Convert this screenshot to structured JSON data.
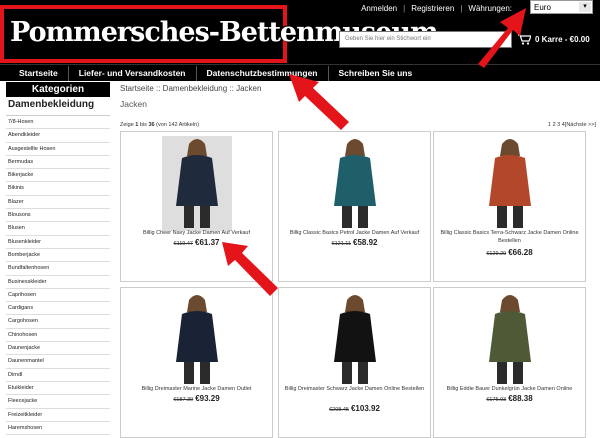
{
  "header": {
    "logo": "Pommersches-Bettenmuseum",
    "links": [
      "Anmelden",
      "Registrieren",
      "Währungen:"
    ],
    "currency": "Euro",
    "search_placeholder": "Geben Sie hier ein Stichwort ein",
    "cart_label": "0 Karre - €0.00"
  },
  "nav": [
    "Startseite",
    "Liefer- und Versandkosten",
    "Datenschutzbestimmungen",
    "Schreiben Sie uns"
  ],
  "sidebar": {
    "title": "Kategorien",
    "subtitle": "Damenbekleidung",
    "items": [
      "7/8-Hosen",
      "Abendkleider",
      "Ausgestellte Hosen",
      "Bermudas",
      "Bikerjacke",
      "Bikinis",
      "Blazer",
      "Blousons",
      "Blusen",
      "Blusenkleider",
      "Bomberjacke",
      "Bundfaltenhosen",
      "Businesskleider",
      "Caprihosen",
      "Cardigans",
      "Cargohosen",
      "Chinohosen",
      "Daunenjacke",
      "Daunenmantel",
      "Dirndl",
      "Etuikleider",
      "Fleecejacke",
      "Freizeitkleider",
      "Haremshosen"
    ]
  },
  "main": {
    "breadcrumb": "Startseite :: Damenbekleidung :: Jacken",
    "title": "Jacken",
    "count_prefix": "Zeige ",
    "count_from": "1",
    "count_mid": " bis ",
    "count_to": "36",
    "count_suffix": " (von 142 Artikeln)",
    "pager": "1 2 3 4[Nächste >>]"
  },
  "products": [
    {
      "name": "Billig Cheer Navy Jacke Damen Auf Verkauf",
      "old_price": "€119.47",
      "price": "€61.37",
      "color": "#1f2a3c"
    },
    {
      "name": "Billig Classic Basics Petrol Jacke Damen Auf Verkauf",
      "old_price": "€121.11",
      "price": "€58.92",
      "color": "#1f5f6a"
    },
    {
      "name": "Billig Classic Basics Terra-Schwarz Jacke Damen Online Bestellen",
      "old_price": "€129.29",
      "price": "€66.28",
      "color": "#b2472a"
    },
    {
      "name": "Billig Dreimaster Marine Jacke Damen Outlet",
      "old_price": "€187.39",
      "price": "€93.29",
      "color": "#1a2236"
    },
    {
      "name": "Billig Dreimaster Schwarz Jacke Damen Online Bestellen",
      "old_price": "€208.45",
      "price": "€103.92",
      "color": "#121212"
    },
    {
      "name": "Billig Eddie Bauer Dunkelgrün Jacke Damen Online",
      "old_price": "€175.93",
      "price": "€88.38",
      "color": "#4e5a36"
    }
  ],
  "colors": {
    "accent_red": "#e4141b",
    "header_bg": "#000000"
  }
}
